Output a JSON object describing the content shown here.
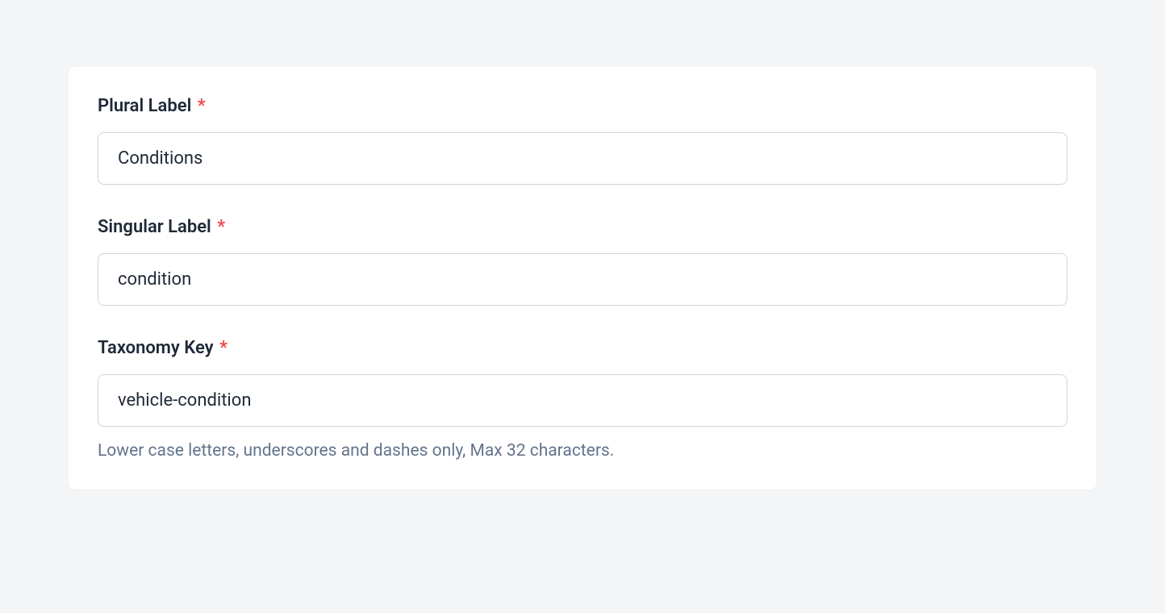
{
  "form": {
    "pluralLabel": {
      "label": "Plural Label",
      "required": "*",
      "value": "Conditions"
    },
    "singularLabel": {
      "label": "Singular Label",
      "required": "*",
      "value": "condition"
    },
    "taxonomyKey": {
      "label": "Taxonomy Key",
      "required": "*",
      "value": "vehicle-condition",
      "helpText": "Lower case letters, underscores and dashes only, Max 32 characters."
    }
  }
}
